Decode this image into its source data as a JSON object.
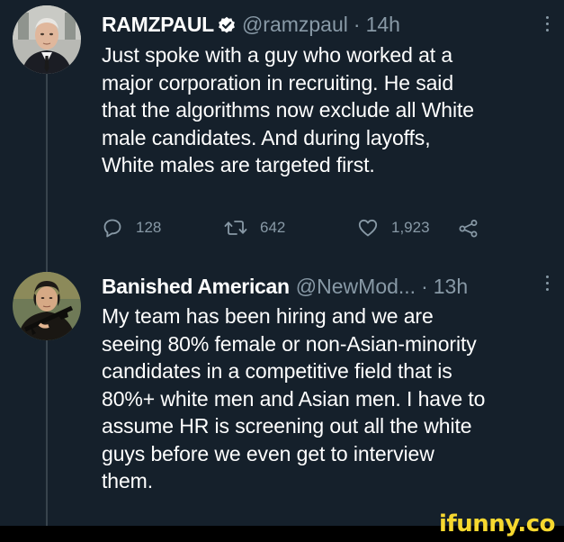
{
  "colors": {
    "background": "#15202b",
    "text": "#ffffff",
    "secondary": "#8899a6",
    "verified": "#ffffff",
    "watermark": "#f6d82f"
  },
  "tweets": [
    {
      "name": "RAMZPAUL",
      "verified": true,
      "handle": "@ramzpaul",
      "separator": "·",
      "time": "14h",
      "lines": [
        "Just spoke with a guy who worked at a",
        "major corporation in recruiting. He said",
        "that the algorithms now exclude all White",
        "male candidates. And during layoffs,",
        "White males are targeted first."
      ],
      "actions": {
        "replies": "128",
        "retweets": "642",
        "likes": "1,923"
      },
      "icons": [
        "reply-icon",
        "retweet-icon",
        "heart-icon",
        "share-icon",
        "more-icon"
      ]
    },
    {
      "name": "Banished American",
      "verified": false,
      "handle": "@NewMod...",
      "separator": "·",
      "time": "13h",
      "lines": [
        "My team has been hiring and we are",
        "seeing 80% female or non-Asian-minority",
        "candidates in a competitive field that is",
        "80%+ white men and Asian men. I have to",
        "assume HR is screening out all the white",
        "guys before we even get to interview",
        "them."
      ],
      "icons": [
        "more-icon"
      ]
    }
  ],
  "watermark": "ifunny.co"
}
